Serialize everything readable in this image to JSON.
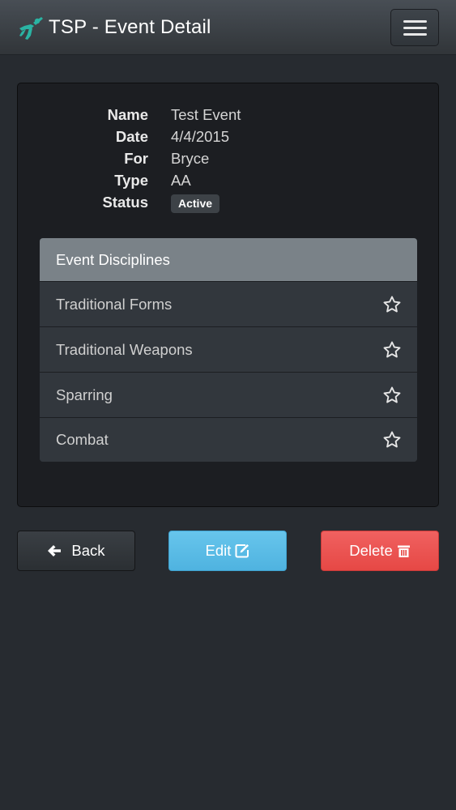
{
  "navbar": {
    "title": "TSP - Event Detail",
    "logo_icon": "martial-arts-kick-icon",
    "menu_icon": "hamburger-icon"
  },
  "event": {
    "fields": [
      {
        "label": "Name",
        "value": "Test Event"
      },
      {
        "label": "Date",
        "value": "4/4/2015"
      },
      {
        "label": "For",
        "value": "Bryce"
      },
      {
        "label": "Type",
        "value": "AA"
      }
    ],
    "status_label": "Status",
    "status_value": "Active"
  },
  "disciplines": {
    "header": "Event Disciplines",
    "items": [
      {
        "label": "Traditional Forms",
        "icon": "star-icon"
      },
      {
        "label": "Traditional Weapons",
        "icon": "star-icon"
      },
      {
        "label": "Sparring",
        "icon": "star-icon"
      },
      {
        "label": "Combat",
        "icon": "star-icon"
      }
    ]
  },
  "actions": {
    "back_label": "Back",
    "edit_label": "Edit",
    "delete_label": "Delete"
  },
  "colors": {
    "background": "#272b30",
    "edit_accent": "#5bc0de",
    "delete_accent": "#ee5f5b",
    "logo": "#2ab3a3"
  }
}
